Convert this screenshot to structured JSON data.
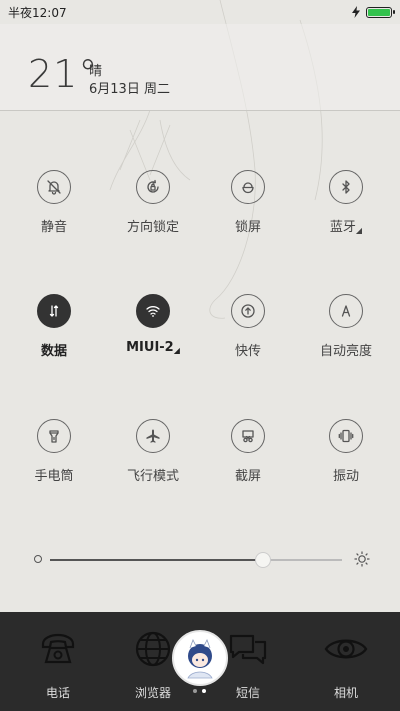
{
  "status": {
    "time": "半夜12:07",
    "battery_level": 1.0,
    "battery_color": "#33c24d",
    "charging": true
  },
  "weather": {
    "temperature": "21°",
    "condition": "晴",
    "date": "6月13日 周二"
  },
  "toggles": [
    {
      "label": "静音",
      "icon": "bell-off-icon",
      "active": false
    },
    {
      "label": "方向锁定",
      "icon": "rotation-lock-icon",
      "active": false
    },
    {
      "label": "锁屏",
      "icon": "lock-icon",
      "active": false
    },
    {
      "label": "蓝牙",
      "icon": "bluetooth-icon",
      "active": false,
      "has_menu": true
    },
    {
      "label": "数据",
      "icon": "mobile-data-icon",
      "active": true
    },
    {
      "label": "MIUI-2",
      "icon": "wifi-icon",
      "active": true,
      "has_menu": true
    },
    {
      "label": "快传",
      "icon": "quick-share-icon",
      "active": false
    },
    {
      "label": "自动亮度",
      "icon": "auto-brightness-icon",
      "active": false
    },
    {
      "label": "手电筒",
      "icon": "flashlight-icon",
      "active": false
    },
    {
      "label": "飞行模式",
      "icon": "airplane-icon",
      "active": false
    },
    {
      "label": "截屏",
      "icon": "screenshot-icon",
      "active": false
    },
    {
      "label": "振动",
      "icon": "vibrate-icon",
      "active": false
    }
  ],
  "brightness": {
    "level": 0.73
  },
  "dock": [
    {
      "label": "电话",
      "icon": "phone-icon"
    },
    {
      "label": "浏览器",
      "icon": "globe-icon"
    },
    {
      "label": "短信",
      "icon": "message-icon"
    },
    {
      "label": "相机",
      "icon": "eye-camera-icon"
    }
  ],
  "pager": {
    "pages": 2,
    "current": 2
  }
}
